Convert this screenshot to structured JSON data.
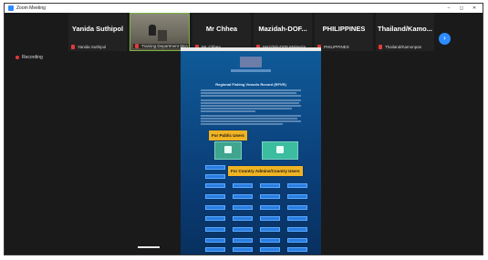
{
  "window": {
    "title": "Zoom Meeting"
  },
  "titlebar": {
    "min": "–",
    "max": "◻",
    "close": "✕"
  },
  "participants": [
    {
      "name": "Yanida Suthipol",
      "sub": "Yanida Suthipol",
      "video": false
    },
    {
      "name": "",
      "sub": "Training Department SEA",
      "video": true
    },
    {
      "name": "Mr Chhea",
      "sub": "Mr. Chhea",
      "video": false
    },
    {
      "name": "Mazidah-DOF...",
      "sub": "Mazidah-DOF Malaysia",
      "video": false
    },
    {
      "name": "PHILIPPINES",
      "sub": "PHILIPPINES",
      "video": false
    },
    {
      "name": "Thailand/Kamo...",
      "sub": "Thailand/Kamonpan",
      "video": false
    }
  ],
  "next_button": "›",
  "recording": {
    "label": "Recording"
  },
  "shared_screen": {
    "site_title": "Regional Fishing Vessels Record (RFVR)",
    "callouts": {
      "public": "For Public Users",
      "admin": "For Country Admins/Country Users"
    }
  }
}
